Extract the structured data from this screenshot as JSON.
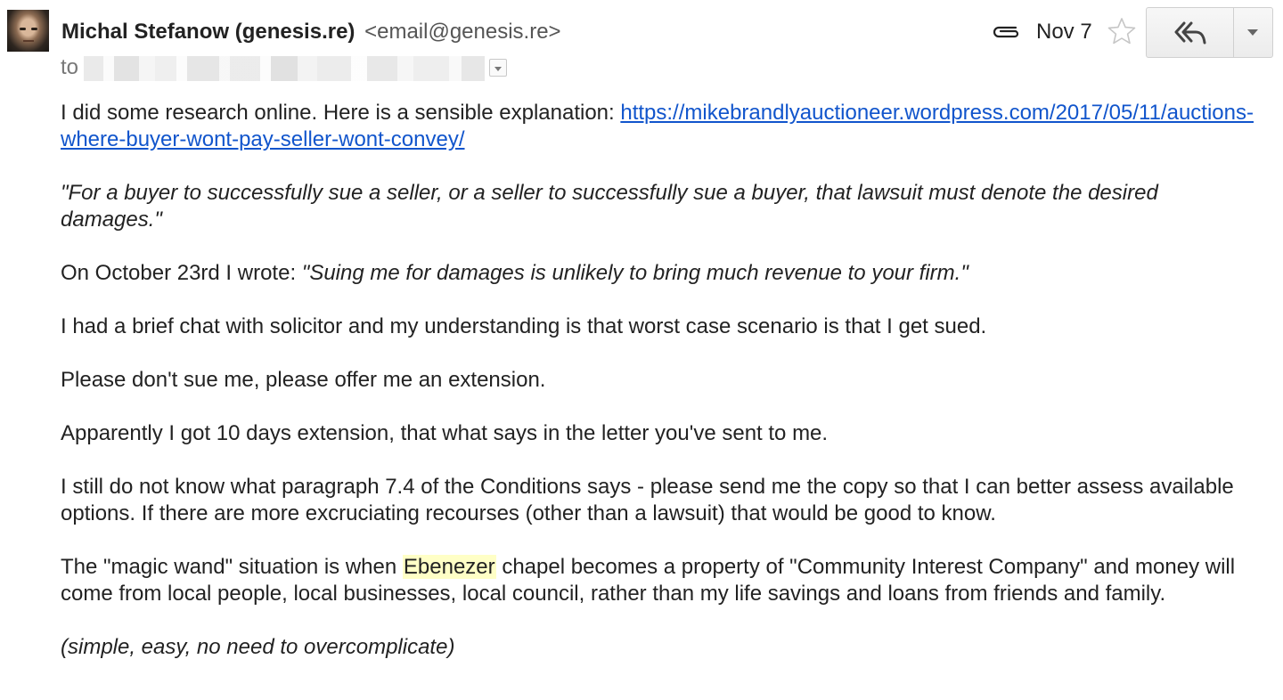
{
  "header": {
    "sender_name": "Michal Stefanow (genesis.re)",
    "sender_email": "<email@genesis.re>",
    "to_label": "to",
    "date": "Nov 7"
  },
  "icons": {
    "avatar": "sender-avatar",
    "attachment": "paperclip-icon",
    "star": "star-outline-icon",
    "reply_all": "reply-all-icon",
    "more": "chevron-down-icon"
  },
  "colors": {
    "link": "#1155cc",
    "highlight": "#ffffc6",
    "text": "#222222"
  },
  "message": {
    "p1_text": "I did some research online. Here is a sensible explanation: ",
    "p1_link": "https://mikebrandlyauctioneer.wordpress.com/2017/05/11/auctions-where-buyer-wont-pay-seller-wont-convey/",
    "p2_quote": "\"For a buyer to successfully sue a seller, or a seller to successfully sue a buyer, that lawsuit must denote the desired damages.\"",
    "p3_text": "On October 23rd I wrote: ",
    "p3_quote": "\"Suing me for damages is unlikely to bring much revenue to your firm.\"",
    "p4": "I had a brief chat with solicitor and my understanding is that worst case scenario is that I get sued.",
    "p5": "Please don't sue me, please offer me an extension.",
    "p6": "Apparently I got 10 days extension, that what says in the letter you've sent to me.",
    "p7": "I still do not know what paragraph 7.4 of the Conditions says - please send me the copy so that I can better assess available options. If there are more excruciating recourses (other than a lawsuit) that would be good to know.",
    "p8_before": "The \"magic wand\" situation is when ",
    "p8_highlight": "Ebenezer",
    "p8_after": " chapel becomes a property of \"Community Interest Company\" and money will come from local people, local businesses, local council, rather than my life savings and loans from friends and family.",
    "p9": "(simple, easy, no need to overcomplicate)"
  }
}
